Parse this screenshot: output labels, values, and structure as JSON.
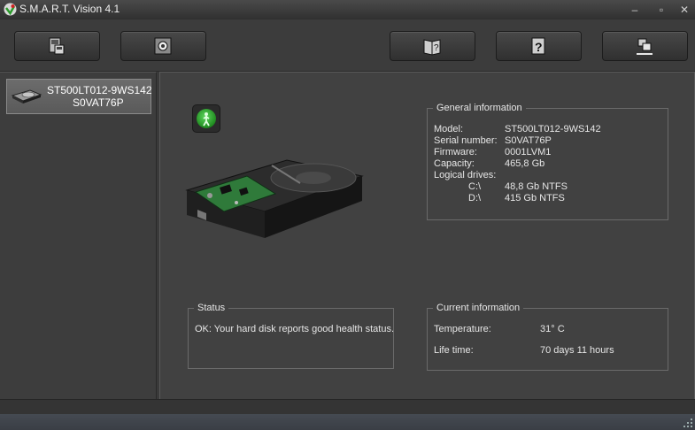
{
  "window": {
    "title": "S.M.A.R.T. Vision 4.1"
  },
  "toolbar": {
    "buttons": [
      {
        "icon": "disk-report-icon"
      },
      {
        "icon": "settings-gear-icon"
      },
      {
        "icon": "help-book-icon"
      },
      {
        "icon": "help-question-icon"
      },
      {
        "icon": "minimize-to-tray-icon"
      }
    ]
  },
  "disks": [
    {
      "model": "ST500LT012-9WS142",
      "serial": "S0VAT76P"
    }
  ],
  "general": {
    "legend": "General information",
    "model_label": "Model:",
    "model_value": "ST500LT012-9WS142",
    "serial_label": "Serial number:",
    "serial_value": "S0VAT76P",
    "firmware_label": "Firmware:",
    "firmware_value": "0001LVM1",
    "capacity_label": "Capacity:",
    "capacity_value": "465,8 Gb",
    "logical_label": "Logical drives:",
    "drives": [
      {
        "letter": "C:\\",
        "info": "48,8 Gb  NTFS"
      },
      {
        "letter": "D:\\",
        "info": "415 Gb  NTFS"
      }
    ]
  },
  "status": {
    "legend": "Status",
    "text": "OK: Your hard disk reports good health status."
  },
  "current": {
    "legend": "Current information",
    "temperature_label": "Temperature:",
    "temperature_value": "31° C",
    "lifetime_label": "Life time:",
    "lifetime_value": "70 days 11 hours"
  },
  "colors": {
    "health_led": "#2fbf2f",
    "background": "#414141"
  }
}
